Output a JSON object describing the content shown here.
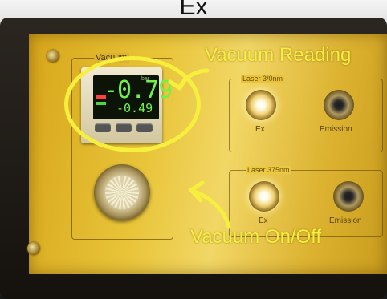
{
  "header_text": "Ex",
  "vacuum_panel": {
    "label": "Vacuum",
    "gauge": {
      "reading_main": "-0.79",
      "reading_sub": "-0.49",
      "unit": "bar"
    }
  },
  "panels": [
    {
      "title": "Laser 3/0nm",
      "left_label": "Ex",
      "right_label": "Emission"
    },
    {
      "title": "Laser 375nm",
      "left_label": "Ex",
      "right_label": "Emission"
    }
  ],
  "annotations": {
    "vacuum_reading": "Vacuum Reading",
    "vacuum_on_off": "Vacuum On/Off",
    "color": "#f7ef3e"
  }
}
